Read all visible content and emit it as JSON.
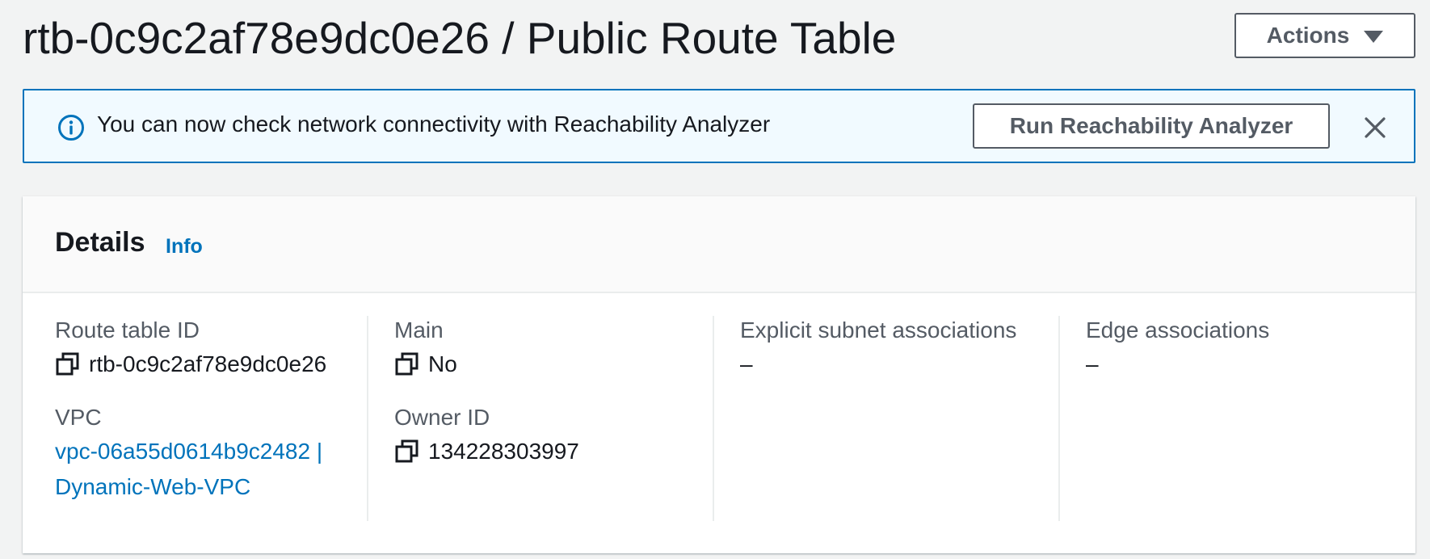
{
  "header": {
    "title": "rtb-0c9c2af78e9dc0e26 / Public Route Table",
    "actions_label": "Actions"
  },
  "flash": {
    "message": "You can now check network connectivity with Reachability Analyzer",
    "button_label": "Run Reachability Analyzer",
    "icon": "info-circle-icon"
  },
  "details": {
    "title": "Details",
    "info_label": "Info",
    "route_table_id": {
      "label": "Route table ID",
      "value": "rtb-0c9c2af78e9dc0e26"
    },
    "vpc": {
      "label": "VPC",
      "value": "vpc-06a55d0614b9c2482 | Dynamic-Web-VPC"
    },
    "main": {
      "label": "Main",
      "value": "No"
    },
    "owner_id": {
      "label": "Owner ID",
      "value": "134228303997"
    },
    "explicit_subnet_associations": {
      "label": "Explicit subnet associations",
      "value": "–"
    },
    "edge_associations": {
      "label": "Edge associations",
      "value": "–"
    }
  },
  "colors": {
    "link": "#0073bb",
    "info_border": "#0073bb",
    "info_background": "#f1faff",
    "page_background": "#f2f3f3"
  }
}
